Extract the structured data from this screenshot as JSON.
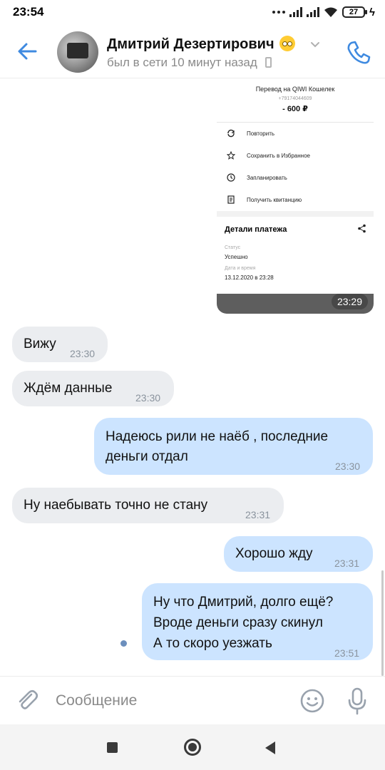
{
  "status_bar": {
    "time": "23:54",
    "battery": "27"
  },
  "header": {
    "contact_name": "Дмитрий Дезертирович",
    "last_seen": "был в сети 10 минут назад",
    "accent_color": "#3f8ae0"
  },
  "attachment": {
    "title": "Перевод на QIWI Кошелек",
    "phone": "+79174044609",
    "amount": "- 600 ₽",
    "actions": [
      {
        "label": "Повторить",
        "icon": "repeat-icon"
      },
      {
        "label": "Сохранить в Избранное",
        "icon": "star-icon"
      },
      {
        "label": "Запланировать",
        "icon": "clock-icon"
      },
      {
        "label": "Получить квитанцию",
        "icon": "receipt-icon"
      }
    ],
    "details_title": "Детали платежа",
    "status_label": "Статус",
    "status_value": "Успешно",
    "datetime_label": "Дата и время",
    "datetime_value": "13.12.2020 в 23:28",
    "time": "23:29"
  },
  "messages": [
    {
      "direction": "in",
      "text": "Вижу",
      "time": "23:30"
    },
    {
      "direction": "in",
      "text": "Ждём данные",
      "time": "23:30"
    },
    {
      "direction": "out",
      "lines": [
        "Надеюсь рили не наёб , последние",
        "деньги отдал"
      ],
      "time": "23:30"
    },
    {
      "direction": "in",
      "text": "Ну наебывать точно не стану",
      "time": "23:31"
    },
    {
      "direction": "out",
      "text": "Хорошо жду",
      "time": "23:31"
    },
    {
      "direction": "out",
      "lines": [
        "Ну что Дмитрий, долго ещё?",
        "Вроде деньги сразу скинул",
        "А то скоро уезжать"
      ],
      "time": "23:51"
    }
  ],
  "composer": {
    "placeholder": "Сообщение"
  }
}
